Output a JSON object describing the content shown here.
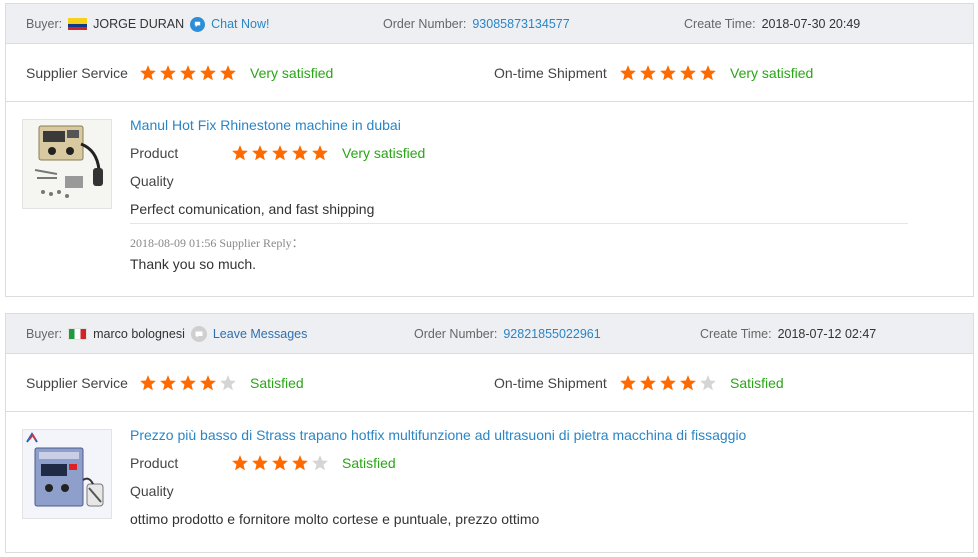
{
  "colors": {
    "star_full": "#ff6a00",
    "star_empty": "#d5d5d5",
    "link": "#2a85c5",
    "satisfaction": "#2aa516"
  },
  "orders": [
    {
      "buyer_label": "Buyer:",
      "buyer_flag_icon": "colombia-flag-icon",
      "buyer_name": "JORGE DURAN",
      "contact_icon": "chat-icon",
      "contact_label": "Chat Now!",
      "order_number_label": "Order Number:",
      "order_number": "93085873134577",
      "create_time_label": "Create Time:",
      "create_time": "2018-07-30 20:49",
      "supplier_service_label": "Supplier Service",
      "supplier_service_stars": 5,
      "supplier_service_text": "Very satisfied",
      "shipment_label": "On-time Shipment",
      "shipment_stars": 5,
      "shipment_text": "Very satisfied",
      "product_title": "Manul Hot Fix Rhinestone machine in dubai",
      "product_label": "Product",
      "product_stars": 5,
      "product_text": "Very satisfied",
      "quality_label": "Quality",
      "comment": "Perfect comunication, and fast shipping",
      "reply_meta": "2018-08-09 01:56  Supplier Reply：",
      "reply": "Thank you so much."
    },
    {
      "buyer_label": "Buyer:",
      "buyer_flag_icon": "italy-flag-icon",
      "buyer_name": "marco bolognesi",
      "contact_icon": "message-icon",
      "contact_label": "Leave Messages",
      "order_number_label": "Order Number:",
      "order_number": "92821855022961",
      "create_time_label": "Create Time:",
      "create_time": "2018-07-12 02:47",
      "supplier_service_label": "Supplier Service",
      "supplier_service_stars": 4,
      "supplier_service_text": "Satisfied",
      "shipment_label": "On-time Shipment",
      "shipment_stars": 4,
      "shipment_text": "Satisfied",
      "product_title": "Prezzo più basso di Strass trapano hotfix multifunzione ad ultrasuoni di pietra macchina di fissaggio",
      "product_label": "Product",
      "product_stars": 4,
      "product_text": "Satisfied",
      "quality_label": "Quality",
      "comment": "ottimo prodotto e fornitore molto cortese e puntuale, prezzo ottimo"
    }
  ]
}
